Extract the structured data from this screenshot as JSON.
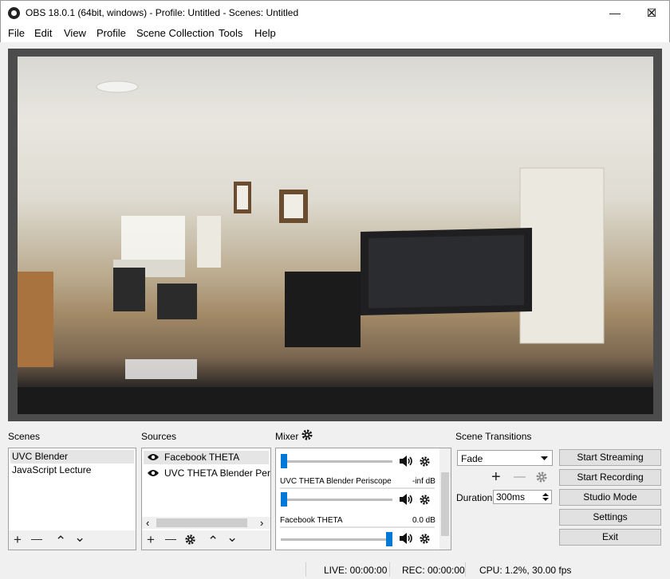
{
  "window": {
    "title": "OBS 18.0.1 (64bit, windows) - Profile: Untitled - Scenes: Untitled",
    "controls": {
      "minimize": "—",
      "maximize": "☐",
      "close": "✕"
    }
  },
  "menu": [
    "File",
    "Edit",
    "View",
    "Profile",
    "Scene Collection",
    "Tools",
    "Help"
  ],
  "panels": {
    "scenes": {
      "label": "Scenes",
      "items": [
        "UVC Blender",
        "JavaScript Lecture"
      ],
      "selected": 0
    },
    "sources": {
      "label": "Sources",
      "items": [
        "Facebook THETA",
        "UVC THETA Blender Periscope"
      ],
      "selected": 0
    },
    "mixer": {
      "label": "Mixer",
      "channels": [
        {
          "name": "",
          "level": "",
          "fader": 0.0
        },
        {
          "name": "UVC THETA Blender Periscope",
          "level": "-inf dB",
          "fader": 0.0
        },
        {
          "name": "Facebook THETA",
          "level": "0.0 dB",
          "fader": 1.0
        }
      ]
    },
    "transitions": {
      "label": "Scene Transitions",
      "selected": "Fade",
      "duration_label": "Duration",
      "duration_value": "300ms"
    }
  },
  "controls": [
    "Start Streaming",
    "Start Recording",
    "Studio Mode",
    "Settings",
    "Exit"
  ],
  "toolbar_glyphs": {
    "add": "+",
    "remove": "—",
    "up": "⌃",
    "down": "⌄",
    "left": "‹",
    "right": "›"
  },
  "status": {
    "live": "LIVE: 00:00:00",
    "rec": "REC: 00:00:00",
    "cpu": "CPU: 1.2%, 30.00 fps"
  },
  "colors": {
    "accent": "#0078d7",
    "preview_bg": "#4c4c4c",
    "selection": "#e5e5e5"
  }
}
